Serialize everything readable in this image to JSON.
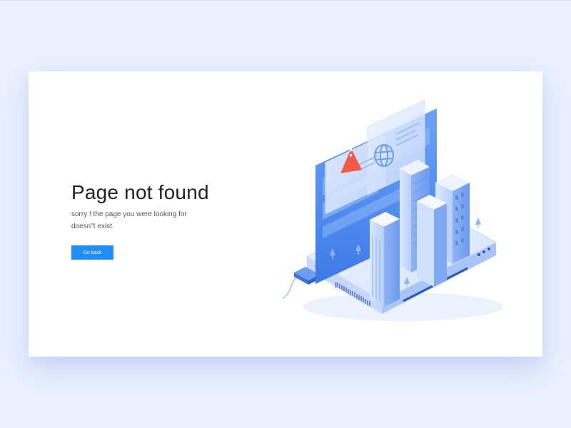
{
  "page": {
    "title": "Page not found",
    "message": "sorry ! the page you were looking for doesn\"t exist.",
    "button_label": "Go back"
  },
  "colors": {
    "background": "#eaf0fe",
    "card": "#ffffff",
    "accent": "#1e8dff",
    "warning": "#f25a4a",
    "illustration_blue": "#4f8cf0"
  },
  "icons": [
    "warning-icon",
    "globe-icon",
    "server-illustration"
  ]
}
